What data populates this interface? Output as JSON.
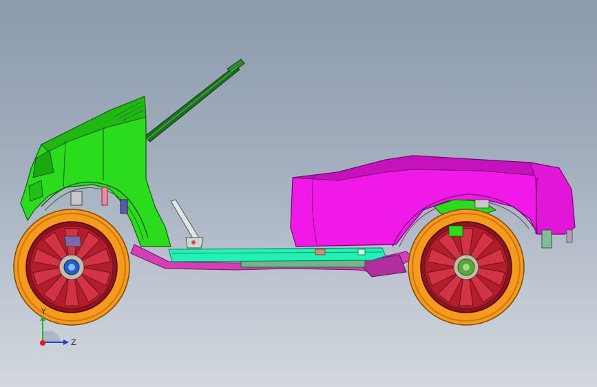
{
  "viewport": {
    "background_top": "#8c9aad",
    "background_bottom": "#d3d8de"
  },
  "model": {
    "colors": {
      "front_body": "#2bdc1c",
      "front_body_shade": "#21b814",
      "rear_body": "#f019e8",
      "rear_body_shade": "#c512bd",
      "floor_panel": "#22f0b4",
      "steering_column": "#1f6e22",
      "tire": "#f59a1c",
      "tire_dark": "#c9770d",
      "rim": "#b31e2c",
      "rim_dark": "#6e0f18",
      "hub_front": "#1c62c9",
      "hub_rear": "#5aa83a",
      "frame_rail": "#d43fb8",
      "exhaust": "#7fbf98"
    }
  },
  "triad": {
    "y_label": "Y",
    "z_label": "Z",
    "y_color": "#2fae2f",
    "z_color": "#1f3fdd",
    "x_color": "#d81e1e"
  }
}
